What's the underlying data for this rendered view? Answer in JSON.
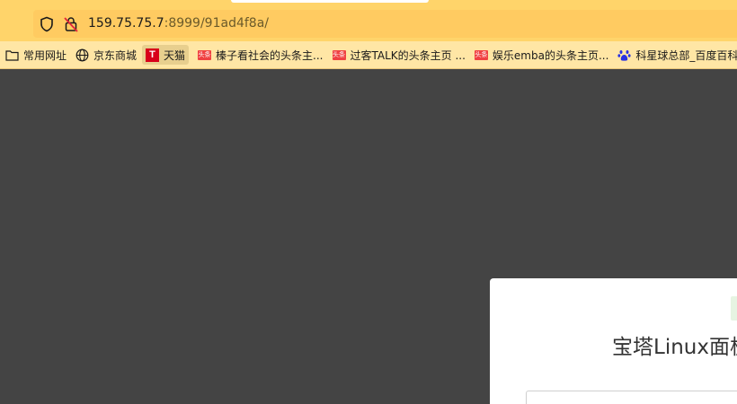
{
  "browser": {
    "url_host": "159.75.75.7",
    "url_path": ":8999/91ad4f8a/",
    "accent": "#ffd46a"
  },
  "bookmarks": [
    {
      "label": "常用网址",
      "icon": "folder-icon"
    },
    {
      "label": "京东商城",
      "icon": "globe-icon"
    },
    {
      "label": "天猫",
      "icon": "tmall-icon",
      "icon_text": "T",
      "active": true
    },
    {
      "label": "榛子看社会的头条主...",
      "icon": "toutiao-icon",
      "icon_text": "头条"
    },
    {
      "label": "过客TALK的头条主页 ...",
      "icon": "toutiao-icon",
      "icon_text": "头条"
    },
    {
      "label": "娱乐emba的头条主页...",
      "icon": "toutiao-icon",
      "icon_text": "头条"
    },
    {
      "label": "科星球总部_百度百科",
      "icon": "baidu-paw-icon"
    }
  ],
  "login": {
    "title": "宝塔Linux面板"
  }
}
